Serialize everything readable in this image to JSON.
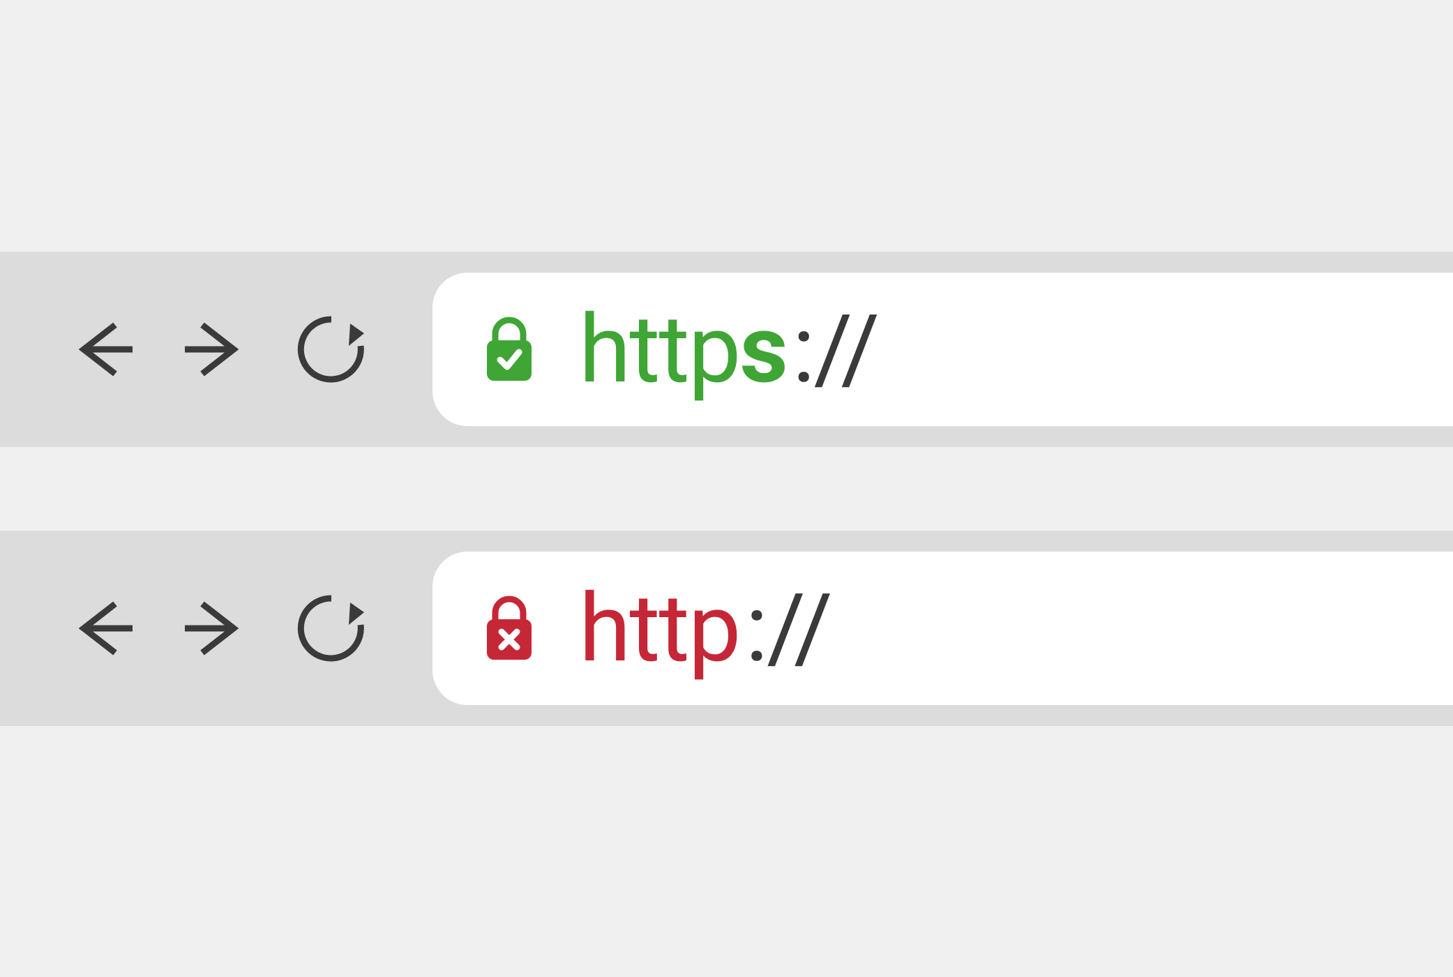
{
  "bars": [
    {
      "security": "secure",
      "lock_color": "#3fa535",
      "protocol_prefix": "http",
      "protocol_suffix": "s",
      "separator": "://"
    },
    {
      "security": "insecure",
      "lock_color": "#c62736",
      "protocol_prefix": "http",
      "protocol_suffix": "",
      "separator": "://"
    }
  ],
  "nav_icon_color": "#3a3a3a"
}
